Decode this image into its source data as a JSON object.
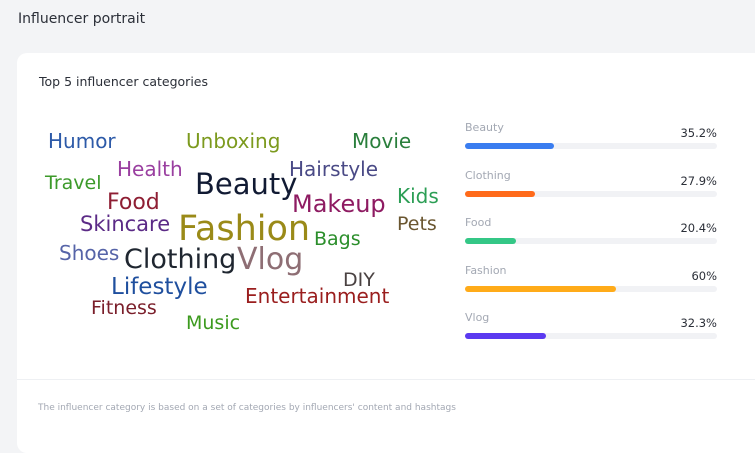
{
  "page": {
    "title": "Influencer portrait"
  },
  "card": {
    "title": "Top 5 influencer categories",
    "footnote": "The influencer category is based on a set of categories by influencers' content and hashtags"
  },
  "word_cloud": [
    {
      "text": "Humor",
      "color": "#2d5aa8"
    },
    {
      "text": "Unboxing",
      "color": "#7c9a1e"
    },
    {
      "text": "Movie",
      "color": "#2a7f3c"
    },
    {
      "text": "Health",
      "color": "#9a3fa0"
    },
    {
      "text": "Hairstyle",
      "color": "#4a4a86"
    },
    {
      "text": "Beauty",
      "color": "#111a33"
    },
    {
      "text": "Travel",
      "color": "#3c9a2a"
    },
    {
      "text": "Food",
      "color": "#8e1e33"
    },
    {
      "text": "Makeup",
      "color": "#8e1b62"
    },
    {
      "text": "Kids",
      "color": "#2c9e55"
    },
    {
      "text": "Skincare",
      "color": "#5b2a86"
    },
    {
      "text": "Fashion",
      "color": "#9a8a18"
    },
    {
      "text": "Pets",
      "color": "#6a5630"
    },
    {
      "text": "Bags",
      "color": "#2b8e2b"
    },
    {
      "text": "Shoes",
      "color": "#5664a8"
    },
    {
      "text": "Clothing",
      "color": "#1f2630"
    },
    {
      "text": "Vlog",
      "color": "#8e6e74"
    },
    {
      "text": "DIY",
      "color": "#4a4242"
    },
    {
      "text": "Lifestyle",
      "color": "#1f4f9e"
    },
    {
      "text": "Entertainment",
      "color": "#9a1e1e"
    },
    {
      "text": "Fitness",
      "color": "#7a1e2a"
    },
    {
      "text": "Music",
      "color": "#3c9a1e"
    }
  ],
  "category_bars": [
    {
      "label": "Beauty",
      "value_text": "35.2%",
      "fill": 0.352,
      "color": "#3a7df0"
    },
    {
      "label": "Clothing",
      "value_text": "27.9%",
      "fill": 0.279,
      "color": "#ff6a1a"
    },
    {
      "label": "Food",
      "value_text": "20.4%",
      "fill": 0.204,
      "color": "#34c786"
    },
    {
      "label": "Fashion",
      "value_text": "60%",
      "fill": 0.6,
      "color": "#ffab19"
    },
    {
      "label": "Vlog",
      "value_text": "32.3%",
      "fill": 0.323,
      "color": "#5b3af0"
    }
  ]
}
